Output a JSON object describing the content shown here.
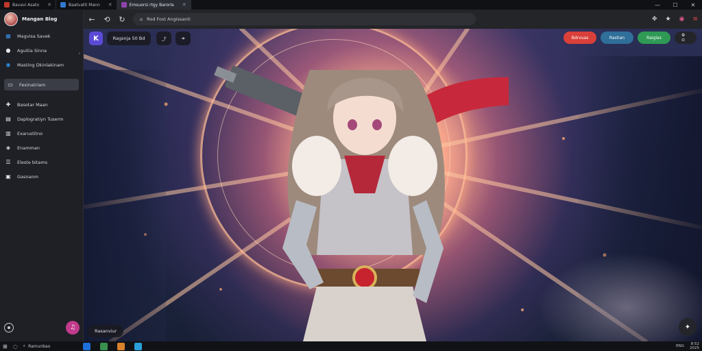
{
  "tabs": [
    {
      "label": "Bavavi Asato",
      "color": "#c0392b",
      "active": false
    },
    {
      "label": "Baatvatti Mann",
      "color": "#2f7ad1",
      "active": false
    },
    {
      "label": "Emsuorsi rtgy Barorla",
      "color": "#8e44ad",
      "active": true
    }
  ],
  "window_controls": {
    "minimize": "—",
    "maximize": "☐",
    "close": "✕"
  },
  "sidebar": {
    "title": "Mangan Blog",
    "items": [
      {
        "label": "Magvisa Savek",
        "icon": "grid-icon"
      },
      {
        "label": "Aguitia Sinna",
        "icon": "circle-icon"
      },
      {
        "label": "Masting Dkinlakinam",
        "icon": "globe-icon"
      },
      {
        "label": "Fexinatriam",
        "icon": "folder-icon",
        "selected": true
      },
      {
        "label": "Basotar Maan",
        "icon": "puzzle-icon"
      },
      {
        "label": "Daplogratiyn Tuserm",
        "icon": "chart-icon"
      },
      {
        "label": "Exarustitno",
        "icon": "book-icon"
      },
      {
        "label": "Enamman",
        "icon": "image-icon"
      },
      {
        "label": "Eleste bitams",
        "icon": "list-icon"
      },
      {
        "label": "Gasnanm",
        "icon": "calendar-icon"
      }
    ]
  },
  "addressbar": {
    "url": "Rod Fost Angissanti",
    "right_icons": [
      "puzzle-icon",
      "star-icon",
      "sync-icon",
      "menu-icon"
    ]
  },
  "content": {
    "app_badge": "K",
    "pill_label": "Ragsnja 50 Bd",
    "chips": [
      {
        "label": "Bdrvuas",
        "color": "#d9403a"
      },
      {
        "label": "Rastian",
        "color": "#2f6f9a"
      },
      {
        "label": "Raiglas",
        "color": "#2f9a55"
      }
    ],
    "chip_extra": "⚙ ⊙",
    "bottom_label": "Rasanviur",
    "fab_icon": "✦"
  },
  "taskbar": {
    "search_label": "Ramunbao",
    "apps": [
      {
        "name": "files-app",
        "color": "#1e6fd9"
      },
      {
        "name": "store-app",
        "color": "#3a8f4c"
      },
      {
        "name": "photos-app",
        "color": "#d9822b"
      },
      {
        "name": "mail-app",
        "color": "#2b9fd9"
      }
    ],
    "tray_text": "ENG",
    "time": "8:52",
    "date": "2025"
  }
}
